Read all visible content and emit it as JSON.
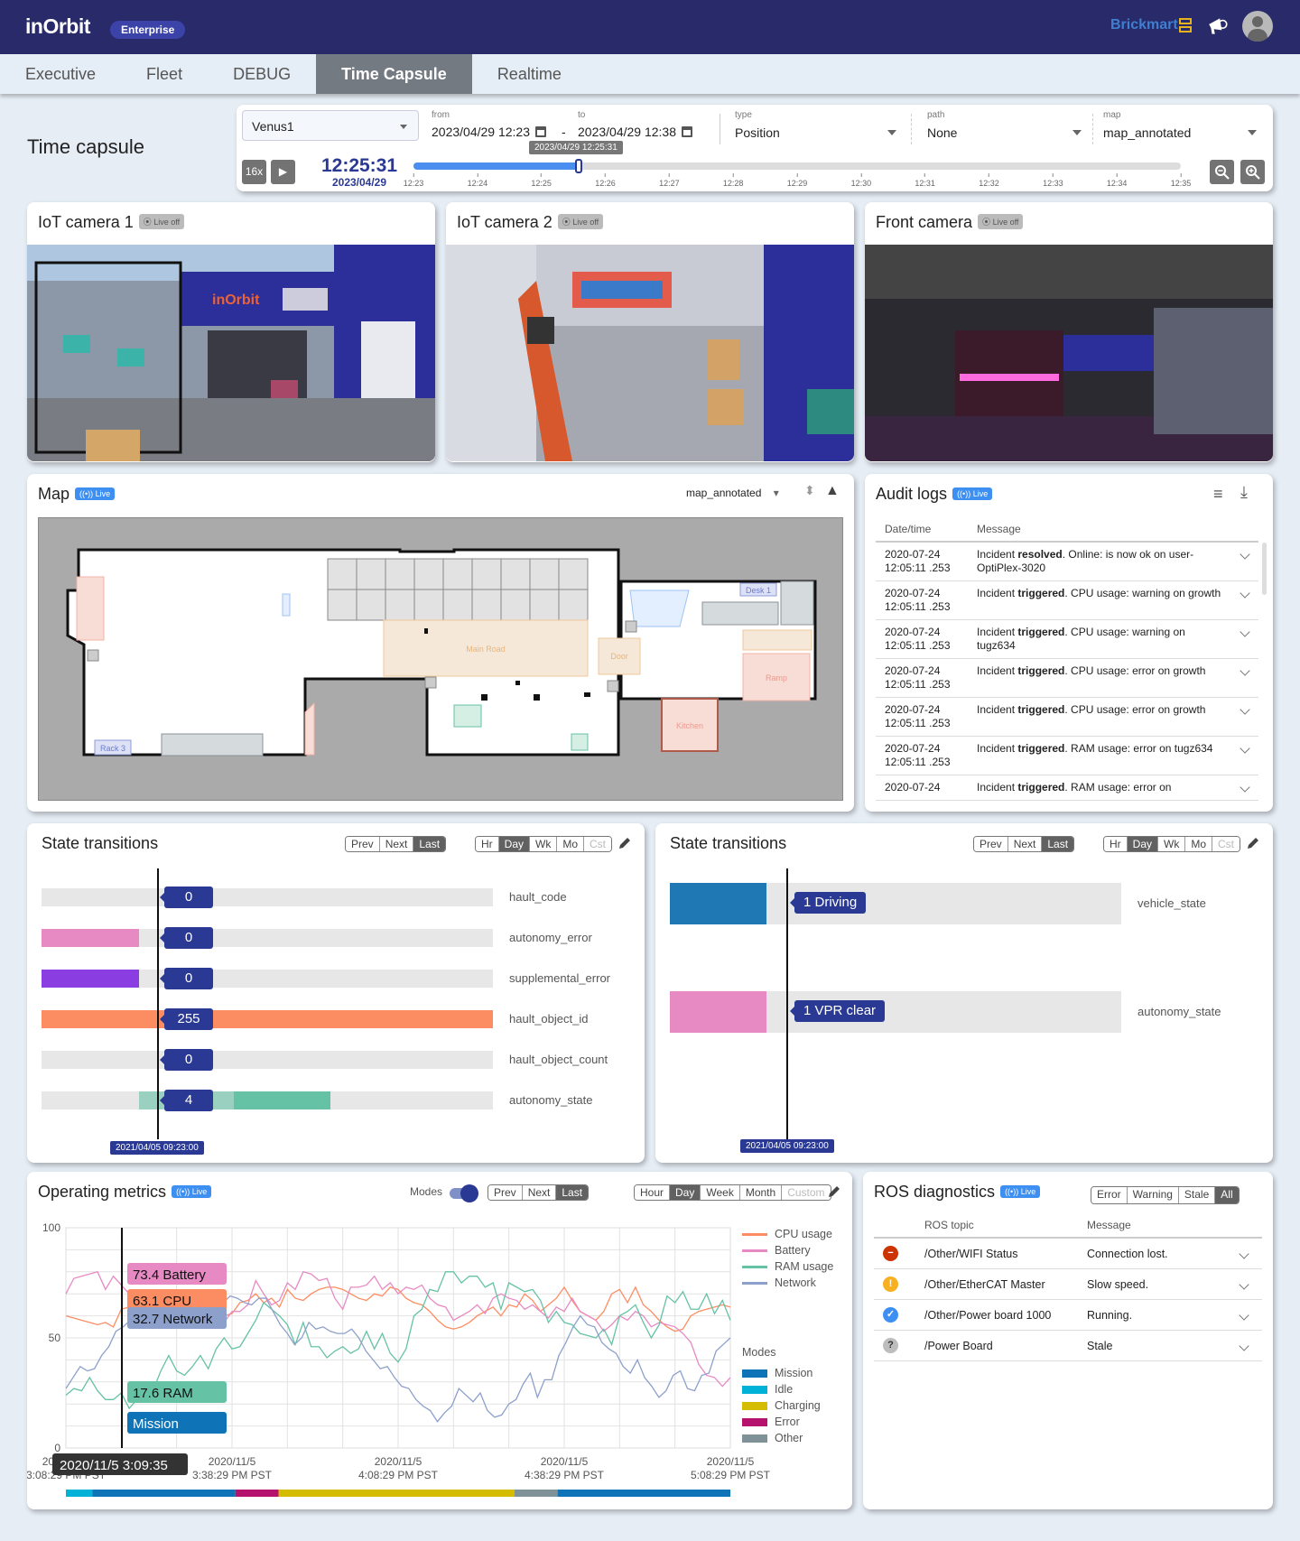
{
  "header": {
    "logo": "inOrbit",
    "edition_badge": "Enterprise",
    "customer_brand": "Brickmart",
    "icons": [
      "brickmart-logo-icon",
      "announcement-megaphone-icon",
      "user-avatar-icon"
    ]
  },
  "tabs": [
    {
      "label": "Executive",
      "active": false
    },
    {
      "label": "Fleet",
      "active": false
    },
    {
      "label": "DEBUG",
      "active": false
    },
    {
      "label": "Time Capsule",
      "active": true
    },
    {
      "label": "Realtime",
      "active": false
    }
  ],
  "page_title": "Time capsule",
  "filter": {
    "robot": "Venus1",
    "from_label": "from",
    "from_value": "2023/04/29 12:23",
    "to_label": "to",
    "to_value": "2023/04/29 12:38",
    "range_separator": "-",
    "type_label": "type",
    "type_value": "Position",
    "path_label": "path",
    "path_value": "None",
    "map_label": "map",
    "map_value": "map_annotated",
    "speed": "16x",
    "current_time": "12:25:31",
    "current_date": "2023/04/29",
    "slider_tooltip": "2023/04/29 12:25:31",
    "timeline_ticks": [
      "12:23",
      "12:24",
      "12:25",
      "12:26",
      "12:27",
      "12:28",
      "12:29",
      "12:30",
      "12:31",
      "12:32",
      "12:33",
      "12:34",
      "12:35"
    ],
    "progress_fraction": 0.215
  },
  "cameras": [
    {
      "title": "IoT camera 1",
      "badge": "Live off"
    },
    {
      "title": "IoT camera 2",
      "badge": "Live off"
    },
    {
      "title": "Front camera",
      "badge": "Live off"
    }
  ],
  "map": {
    "title": "Map",
    "badge": "Live",
    "selected_map": "map_annotated",
    "zones": [
      "Main Road",
      "Door",
      "Desk 1",
      "Ramp",
      "Kitchen",
      "Rack 3"
    ]
  },
  "audit": {
    "title": "Audit logs",
    "badge": "Live",
    "columns": [
      "Date/time",
      "Message"
    ],
    "rows": [
      {
        "date": "2020-07-24",
        "time": "12:05:11 .253",
        "pre": "Incident ",
        "bold": "resolved",
        "post": ". Online: is now ok on user-OptiPlex-3020"
      },
      {
        "date": "2020-07-24",
        "time": "12:05:11 .253",
        "pre": "Incident ",
        "bold": "triggered",
        "post": ". CPU usage: warning on growth"
      },
      {
        "date": "2020-07-24",
        "time": "12:05:11 .253",
        "pre": "Incident ",
        "bold": "triggered",
        "post": ". CPU usage: warning on tugz634"
      },
      {
        "date": "2020-07-24",
        "time": "12:05:11 .253",
        "pre": "Incident ",
        "bold": "triggered",
        "post": ". CPU usage: error on growth"
      },
      {
        "date": "2020-07-24",
        "time": "12:05:11 .253",
        "pre": "Incident ",
        "bold": "triggered",
        "post": ". CPU usage: error on growth"
      },
      {
        "date": "2020-07-24",
        "time": "12:05:11 .253",
        "pre": "Incident ",
        "bold": "triggered",
        "post": ". RAM usage: error on tugz634"
      },
      {
        "date": "2020-07-24",
        "time": "",
        "pre": "Incident ",
        "bold": "triggered",
        "post": ". RAM usage: error on"
      }
    ]
  },
  "nav_buttons": [
    "Prev",
    "Next",
    "Last"
  ],
  "nav_active": "Last",
  "range_buttons_short": [
    "Hr",
    "Day",
    "Wk",
    "Mo",
    "Cst"
  ],
  "range_active_short": "Day",
  "state_left": {
    "title": "State transitions",
    "cursor_time": "2021/04/05 09:23:00",
    "rows": [
      {
        "name": "hault_code",
        "value": "0",
        "color": "#e7e7e7"
      },
      {
        "name": "autonomy_error",
        "value": "0",
        "color": "#e78ac3"
      },
      {
        "name": "supplemental_error",
        "value": "0",
        "color": "#8a3de0"
      },
      {
        "name": "hault_object_id",
        "value": "255",
        "color": "#fc8d62"
      },
      {
        "name": "hault_object_count",
        "value": "0",
        "color": "#e7e7e7"
      },
      {
        "name": "autonomy_state",
        "value": "4",
        "color": "#66c2a5"
      }
    ]
  },
  "state_right": {
    "title": "State transitions",
    "cursor_time": "2021/04/05 09:23:00",
    "rows": [
      {
        "name": "vehicle_state",
        "value": "1 Driving",
        "color": "#1f78b4"
      },
      {
        "name": "autonomy_state",
        "value": "1 VPR clear",
        "color": "#e78ac3"
      }
    ]
  },
  "metrics": {
    "title": "Operating metrics",
    "badge": "Live",
    "modes_label": "Modes",
    "modes_on": true,
    "range_buttons": [
      "Hour",
      "Day",
      "Week",
      "Month",
      "Custom"
    ],
    "range_active": "Day",
    "cursor_time": "2020/11/5 3:09:35",
    "tooltips": [
      "73.4 Battery",
      "63.1 CPU",
      "32.7 Network",
      "17.6 RAM",
      "Mission"
    ]
  },
  "chart_data": {
    "type": "line",
    "title": "Operating metrics",
    "ylim": [
      0,
      100
    ],
    "yticks": [
      0,
      50,
      100
    ],
    "xtick_labels": [
      [
        "2020/11/5",
        "3:08:29 PM PST"
      ],
      [
        "2020/11/5",
        "3:38:29 PM PST"
      ],
      [
        "2020/11/5",
        "4:08:29 PM PST"
      ],
      [
        "2020/11/5",
        "4:38:29 PM PST"
      ],
      [
        "2020/11/5",
        "5:08:29 PM PST"
      ]
    ],
    "grid": true,
    "legend_position": "right",
    "series": [
      {
        "name": "CPU usage",
        "color": "#fc8d62",
        "values": [
          60,
          59,
          58,
          57,
          56,
          57,
          55,
          63,
          64,
          66,
          65,
          67,
          65,
          64,
          65,
          66,
          67,
          63,
          57,
          55,
          60,
          61,
          66,
          67,
          70,
          66,
          68,
          64,
          72,
          68,
          67,
          70,
          72,
          73,
          73,
          72,
          70,
          68,
          67,
          70,
          69,
          73,
          72,
          68,
          66,
          65,
          62,
          58,
          55,
          54,
          55,
          57,
          60,
          62,
          64,
          60,
          65,
          64,
          70,
          67,
          62,
          65,
          68,
          73,
          67,
          62,
          60,
          58,
          62,
          70,
          72,
          66,
          73,
          65,
          62,
          58,
          55,
          53,
          54,
          60,
          62,
          63,
          64,
          65,
          64
        ]
      },
      {
        "name": "Battery",
        "color": "#e78ac3",
        "values": [
          70,
          77,
          78,
          79,
          80,
          72,
          78,
          74,
          70,
          68,
          65,
          66,
          67,
          66,
          67,
          63,
          65,
          66,
          60,
          56,
          57,
          62,
          62,
          65,
          76,
          70,
          65,
          67,
          75,
          72,
          80,
          79,
          76,
          77,
          68,
          63,
          73,
          73,
          74,
          78,
          72,
          75,
          70,
          73,
          72,
          74,
          68,
          65,
          64,
          58,
          60,
          62,
          65,
          61,
          68,
          70,
          68,
          67,
          63,
          65,
          62,
          59,
          64,
          62,
          68,
          62,
          60,
          58,
          53,
          56,
          60,
          58,
          62,
          60,
          55,
          57,
          56,
          55,
          52,
          48,
          38,
          33,
          32,
          28,
          32
        ]
      },
      {
        "name": "RAM usage",
        "color": "#66c2a5",
        "values": [
          24,
          27,
          26,
          32,
          26,
          22,
          22,
          25,
          18,
          22,
          22,
          26,
          35,
          42,
          35,
          33,
          37,
          42,
          36,
          45,
          50,
          45,
          46,
          52,
          58,
          66,
          63,
          60,
          56,
          47,
          57,
          46,
          46,
          41,
          44,
          46,
          43,
          45,
          53,
          45,
          52,
          43,
          39,
          45,
          60,
          63,
          72,
          71,
          80,
          80,
          75,
          78,
          78,
          73,
          75,
          63,
          75,
          73,
          71,
          72,
          67,
          57,
          62,
          57,
          56,
          52,
          51,
          50,
          54,
          47,
          60,
          62,
          65,
          57,
          50,
          56,
          69,
          66,
          71,
          63,
          63,
          70,
          61,
          67,
          58
        ]
      },
      {
        "name": "Network",
        "color": "#8da0cb",
        "values": [
          27,
          32,
          37,
          35,
          36,
          42,
          46,
          53,
          55,
          58,
          60,
          64,
          62,
          62,
          65,
          66,
          64,
          60,
          56,
          55,
          60,
          69,
          66,
          69,
          68,
          66,
          65,
          68,
          68,
          62,
          56,
          52,
          47,
          50,
          57,
          54,
          55,
          53,
          52,
          52,
          54,
          50,
          44,
          40,
          36,
          37,
          32,
          28,
          27,
          22,
          19,
          17,
          12,
          16,
          19,
          27,
          24,
          21,
          25,
          17,
          14,
          15,
          20,
          22,
          29,
          34,
          23,
          31,
          31,
          42,
          48,
          55,
          60,
          56,
          55,
          48,
          45,
          43,
          37,
          34,
          40,
          32,
          28,
          23,
          26,
          33,
          35,
          27,
          26,
          33,
          34,
          44,
          47,
          50
        ]
      }
    ],
    "modes": {
      "legend_title": "Modes",
      "legend": [
        {
          "name": "Mission",
          "color": "#0f73b7"
        },
        {
          "name": "Idle",
          "color": "#00b2d8"
        },
        {
          "name": "Charging",
          "color": "#d4bc00"
        },
        {
          "name": "Error",
          "color": "#b5126e"
        },
        {
          "name": "Other",
          "color": "#7f9297"
        }
      ],
      "segments": [
        {
          "mode": "Idle",
          "start": 0.0,
          "end": 0.04
        },
        {
          "mode": "Mission",
          "start": 0.04,
          "end": 0.255
        },
        {
          "mode": "Error",
          "start": 0.255,
          "end": 0.32
        },
        {
          "mode": "Charging",
          "start": 0.32,
          "end": 0.675
        },
        {
          "mode": "Other",
          "start": 0.675,
          "end": 0.74
        },
        {
          "mode": "Mission",
          "start": 0.74,
          "end": 1.0
        }
      ]
    }
  },
  "ros": {
    "title": "ROS diagnostics",
    "badge": "Live",
    "filters": [
      "Error",
      "Warning",
      "Stale",
      "All"
    ],
    "filter_active": "All",
    "columns": [
      "ROS topic",
      "Message"
    ],
    "rows": [
      {
        "status": "error",
        "icon": "error-minus-icon",
        "color": "#cc3300",
        "glyph": "−",
        "topic": "/Other/WIFI Status",
        "message": "Connection lost."
      },
      {
        "status": "warning",
        "icon": "warning-exclamation-icon",
        "color": "#f6b020",
        "glyph": "!",
        "topic": "/Other/EtherCAT Master",
        "message": "Slow speed."
      },
      {
        "status": "ok",
        "icon": "check-circle-icon",
        "color": "#3d8ff2",
        "glyph": "✓",
        "topic": "/Other/Power board 1000",
        "message": "Running."
      },
      {
        "status": "stale",
        "icon": "question-icon",
        "color": "#bdbdbd",
        "glyph": "?",
        "topic": "/Power Board",
        "message": "Stale"
      }
    ]
  }
}
